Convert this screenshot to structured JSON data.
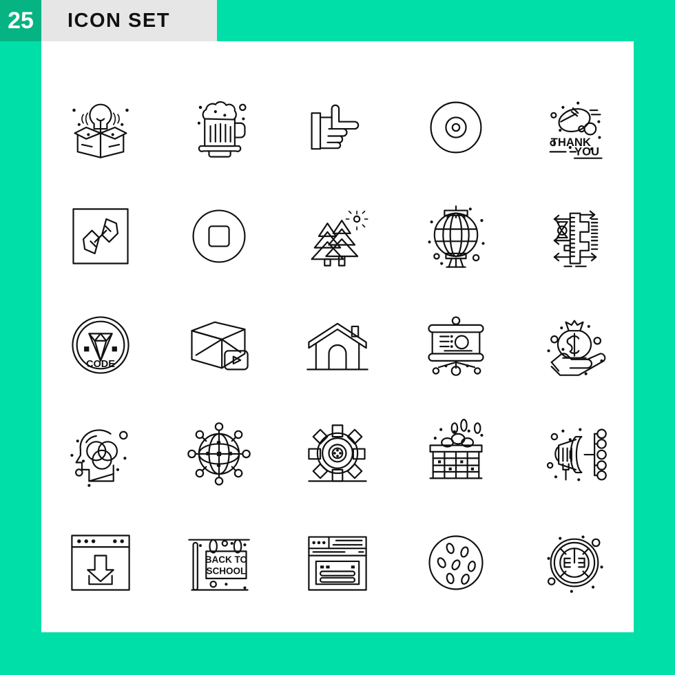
{
  "header": {
    "count": "25",
    "title": "ICON SET",
    "badge_color": "#06b383",
    "band_color": "#e6e6e6",
    "background_color": "#00dfa8",
    "panel_color": "#ffffff",
    "stroke_color": "#111111"
  },
  "grid": {
    "columns": 5,
    "rows": 5,
    "total": 25,
    "icons": [
      {
        "index": 1,
        "name": "idea-box-lightbulb-icon",
        "label": "Idea"
      },
      {
        "index": 2,
        "name": "beer-mug-icon",
        "label": "Beer"
      },
      {
        "index": 3,
        "name": "pointing-hand-icon",
        "label": "Hand"
      },
      {
        "index": 4,
        "name": "compact-disc-icon",
        "label": "Disc"
      },
      {
        "index": 5,
        "name": "thank-you-card-icon",
        "label": "Thank You",
        "text_line1": "THANK",
        "text_line2": "YOU"
      },
      {
        "index": 6,
        "name": "link-square-icon",
        "label": "Link"
      },
      {
        "index": 7,
        "name": "stop-button-icon",
        "label": "Stop"
      },
      {
        "index": 8,
        "name": "forest-trees-icon",
        "label": "Forest"
      },
      {
        "index": 9,
        "name": "chinese-lantern-icon",
        "label": "Lantern"
      },
      {
        "index": 10,
        "name": "caliper-measure-icon",
        "label": "Caliper"
      },
      {
        "index": 11,
        "name": "code-diamond-badge-icon",
        "label": "Code",
        "text": "CODE"
      },
      {
        "index": 12,
        "name": "cube-video-play-icon",
        "label": "3D Video"
      },
      {
        "index": 13,
        "name": "home-house-icon",
        "label": "Home"
      },
      {
        "index": 14,
        "name": "presentation-board-icon",
        "label": "Presentation"
      },
      {
        "index": 15,
        "name": "money-bag-hand-icon",
        "label": "Money"
      },
      {
        "index": 16,
        "name": "head-thinking-circles-icon",
        "label": "Mind"
      },
      {
        "index": 17,
        "name": "global-network-icon",
        "label": "Network"
      },
      {
        "index": 18,
        "name": "gear-settings-icon",
        "label": "Settings"
      },
      {
        "index": 19,
        "name": "egg-basket-crate-icon",
        "label": "Eggs"
      },
      {
        "index": 20,
        "name": "megaphone-marketing-icon",
        "label": "Marketing"
      },
      {
        "index": 21,
        "name": "browser-download-icon",
        "label": "Download"
      },
      {
        "index": 22,
        "name": "back-to-school-sign-icon",
        "label": "Back To School",
        "text_line1": "BACK TO",
        "text_line2": "SCHOOL"
      },
      {
        "index": 23,
        "name": "browser-form-page-icon",
        "label": "Web Form"
      },
      {
        "index": 24,
        "name": "cookie-biscuit-icon",
        "label": "Cookie"
      },
      {
        "index": 25,
        "name": "safe-vault-dial-icon",
        "label": "Safe"
      }
    ]
  }
}
